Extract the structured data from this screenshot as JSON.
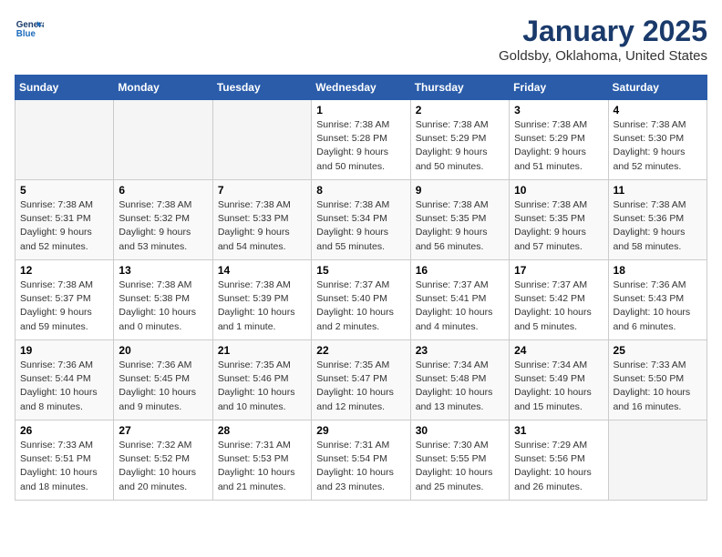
{
  "logo": {
    "text1": "General",
    "text2": "Blue"
  },
  "title": "January 2025",
  "subtitle": "Goldsby, Oklahoma, United States",
  "days_of_week": [
    "Sunday",
    "Monday",
    "Tuesday",
    "Wednesday",
    "Thursday",
    "Friday",
    "Saturday"
  ],
  "weeks": [
    [
      {
        "day": "",
        "info": ""
      },
      {
        "day": "",
        "info": ""
      },
      {
        "day": "",
        "info": ""
      },
      {
        "day": "1",
        "info": "Sunrise: 7:38 AM\nSunset: 5:28 PM\nDaylight: 9 hours\nand 50 minutes."
      },
      {
        "day": "2",
        "info": "Sunrise: 7:38 AM\nSunset: 5:29 PM\nDaylight: 9 hours\nand 50 minutes."
      },
      {
        "day": "3",
        "info": "Sunrise: 7:38 AM\nSunset: 5:29 PM\nDaylight: 9 hours\nand 51 minutes."
      },
      {
        "day": "4",
        "info": "Sunrise: 7:38 AM\nSunset: 5:30 PM\nDaylight: 9 hours\nand 52 minutes."
      }
    ],
    [
      {
        "day": "5",
        "info": "Sunrise: 7:38 AM\nSunset: 5:31 PM\nDaylight: 9 hours\nand 52 minutes."
      },
      {
        "day": "6",
        "info": "Sunrise: 7:38 AM\nSunset: 5:32 PM\nDaylight: 9 hours\nand 53 minutes."
      },
      {
        "day": "7",
        "info": "Sunrise: 7:38 AM\nSunset: 5:33 PM\nDaylight: 9 hours\nand 54 minutes."
      },
      {
        "day": "8",
        "info": "Sunrise: 7:38 AM\nSunset: 5:34 PM\nDaylight: 9 hours\nand 55 minutes."
      },
      {
        "day": "9",
        "info": "Sunrise: 7:38 AM\nSunset: 5:35 PM\nDaylight: 9 hours\nand 56 minutes."
      },
      {
        "day": "10",
        "info": "Sunrise: 7:38 AM\nSunset: 5:35 PM\nDaylight: 9 hours\nand 57 minutes."
      },
      {
        "day": "11",
        "info": "Sunrise: 7:38 AM\nSunset: 5:36 PM\nDaylight: 9 hours\nand 58 minutes."
      }
    ],
    [
      {
        "day": "12",
        "info": "Sunrise: 7:38 AM\nSunset: 5:37 PM\nDaylight: 9 hours\nand 59 minutes."
      },
      {
        "day": "13",
        "info": "Sunrise: 7:38 AM\nSunset: 5:38 PM\nDaylight: 10 hours\nand 0 minutes."
      },
      {
        "day": "14",
        "info": "Sunrise: 7:38 AM\nSunset: 5:39 PM\nDaylight: 10 hours\nand 1 minute."
      },
      {
        "day": "15",
        "info": "Sunrise: 7:37 AM\nSunset: 5:40 PM\nDaylight: 10 hours\nand 2 minutes."
      },
      {
        "day": "16",
        "info": "Sunrise: 7:37 AM\nSunset: 5:41 PM\nDaylight: 10 hours\nand 4 minutes."
      },
      {
        "day": "17",
        "info": "Sunrise: 7:37 AM\nSunset: 5:42 PM\nDaylight: 10 hours\nand 5 minutes."
      },
      {
        "day": "18",
        "info": "Sunrise: 7:36 AM\nSunset: 5:43 PM\nDaylight: 10 hours\nand 6 minutes."
      }
    ],
    [
      {
        "day": "19",
        "info": "Sunrise: 7:36 AM\nSunset: 5:44 PM\nDaylight: 10 hours\nand 8 minutes."
      },
      {
        "day": "20",
        "info": "Sunrise: 7:36 AM\nSunset: 5:45 PM\nDaylight: 10 hours\nand 9 minutes."
      },
      {
        "day": "21",
        "info": "Sunrise: 7:35 AM\nSunset: 5:46 PM\nDaylight: 10 hours\nand 10 minutes."
      },
      {
        "day": "22",
        "info": "Sunrise: 7:35 AM\nSunset: 5:47 PM\nDaylight: 10 hours\nand 12 minutes."
      },
      {
        "day": "23",
        "info": "Sunrise: 7:34 AM\nSunset: 5:48 PM\nDaylight: 10 hours\nand 13 minutes."
      },
      {
        "day": "24",
        "info": "Sunrise: 7:34 AM\nSunset: 5:49 PM\nDaylight: 10 hours\nand 15 minutes."
      },
      {
        "day": "25",
        "info": "Sunrise: 7:33 AM\nSunset: 5:50 PM\nDaylight: 10 hours\nand 16 minutes."
      }
    ],
    [
      {
        "day": "26",
        "info": "Sunrise: 7:33 AM\nSunset: 5:51 PM\nDaylight: 10 hours\nand 18 minutes."
      },
      {
        "day": "27",
        "info": "Sunrise: 7:32 AM\nSunset: 5:52 PM\nDaylight: 10 hours\nand 20 minutes."
      },
      {
        "day": "28",
        "info": "Sunrise: 7:31 AM\nSunset: 5:53 PM\nDaylight: 10 hours\nand 21 minutes."
      },
      {
        "day": "29",
        "info": "Sunrise: 7:31 AM\nSunset: 5:54 PM\nDaylight: 10 hours\nand 23 minutes."
      },
      {
        "day": "30",
        "info": "Sunrise: 7:30 AM\nSunset: 5:55 PM\nDaylight: 10 hours\nand 25 minutes."
      },
      {
        "day": "31",
        "info": "Sunrise: 7:29 AM\nSunset: 5:56 PM\nDaylight: 10 hours\nand 26 minutes."
      },
      {
        "day": "",
        "info": ""
      }
    ]
  ]
}
